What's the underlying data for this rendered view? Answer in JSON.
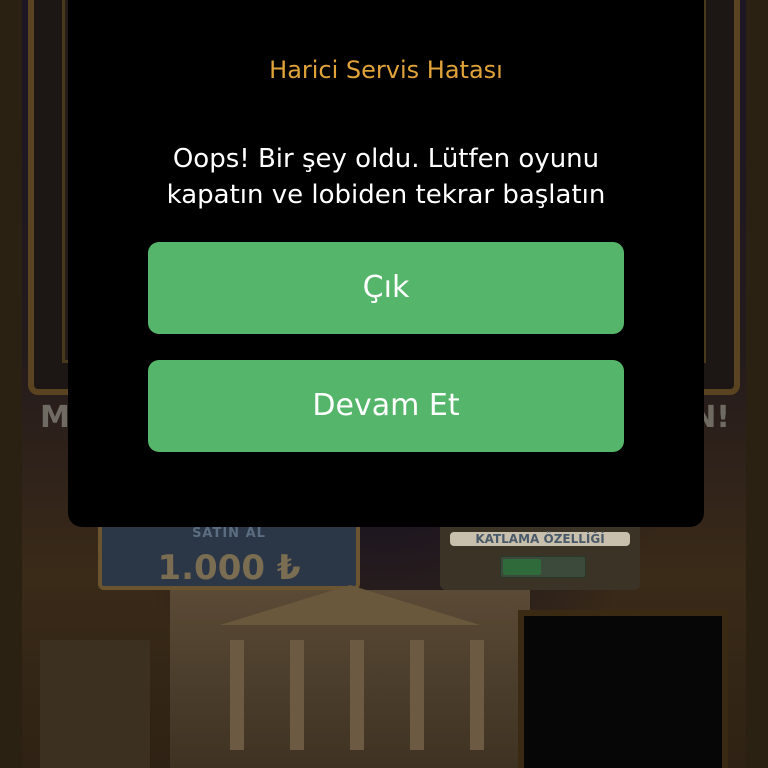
{
  "background": {
    "promo_left": "M",
    "promo_right": "N!",
    "buy_feature_title": "SATIN AL",
    "buy_feature_price": "1.000 ₺",
    "double_chance_label": "KATLAMA ÖZELLİĞİ",
    "double_chance_toggle": "KAPALI"
  },
  "dialog": {
    "title": "Harici Servis Hatası",
    "message": "Oops! Bir şey oldu. Lütfen oyunu kapatın ve lobiden tekrar başlatın",
    "exit_label": "Çık",
    "continue_label": "Devam Et"
  },
  "colors": {
    "title": "#e0a33a",
    "button": "#55b66b",
    "modal": "#000000"
  }
}
